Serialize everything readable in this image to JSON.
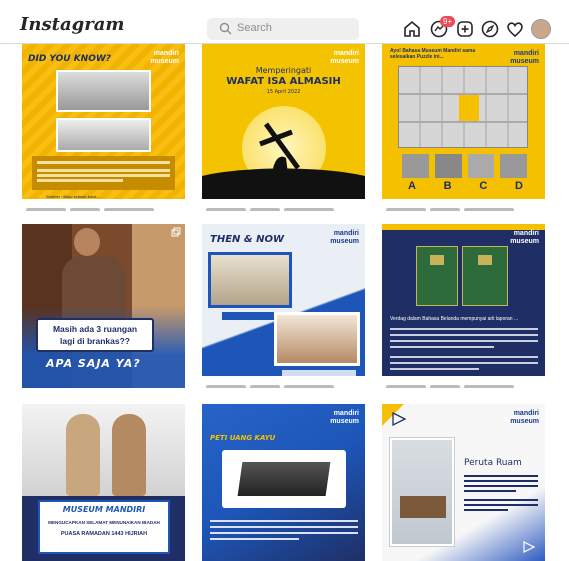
{
  "header": {
    "logo": "Instagram",
    "search_placeholder": "Search",
    "notification_count": "9+"
  },
  "posts": [
    {
      "title": "DID YOU KNOW?",
      "footer": "Sumber : Buku sejarah bank..."
    },
    {
      "title_line1": "Memperingati",
      "title_line2": "WAFAT ISA ALMASIH",
      "date": "15 April 2022"
    },
    {
      "title": "Ayo! Bahasa Museum Mandiri sama selesaikan Puzzle ini...",
      "options": [
        "A",
        "B",
        "C",
        "D"
      ]
    },
    {
      "line1": "Masih ada 3 ruangan",
      "line2": "lagi di brankas??",
      "line3": "APA SAJA YA?"
    },
    {
      "title": "THEN & NOW"
    },
    {
      "caption": "Verdag dalam Bahasa Belanda mempunyai arti laporan ..."
    },
    {
      "title": "MUSEUM MANDIRI",
      "line1": "MENGUCAPKAN SELAMAT MENUNAIKAN IBADAH",
      "line2": "PUASA RAMADAN 1443 HIJRIAH"
    },
    {
      "title": "PETI UANG KAYU"
    },
    {
      "title": "Peruta Ruam"
    }
  ],
  "brand": {
    "name": "mandiri",
    "sub": "museum"
  },
  "colors": {
    "yellow": "#f5c518",
    "navy": "#1f2f66",
    "blue": "#1d56b8"
  }
}
